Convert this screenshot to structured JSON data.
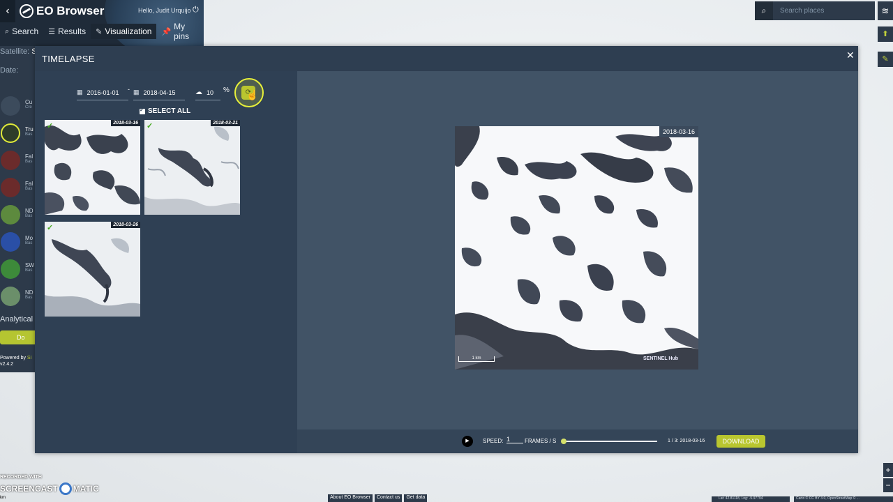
{
  "app": {
    "title": "EO Browser",
    "back_icon": "‹",
    "greeting": "Hello, Judit Urquijo",
    "tabs": [
      {
        "label": "Search",
        "icon": "search-icon"
      },
      {
        "label": "Results",
        "icon": "list-icon"
      },
      {
        "label": "Visualization",
        "icon": "brush-icon",
        "active": true
      },
      {
        "label": "My pins",
        "icon": "pin-icon"
      }
    ],
    "satellite_label": "Satellite:",
    "satellite_value": "S",
    "date_label": "Date:",
    "layers": [
      {
        "t1": "Cu",
        "t2": "Cre",
        "color": "#3c4b5c"
      },
      {
        "t1": "Tru",
        "t2": "Bas",
        "color": "#2e3d2a"
      },
      {
        "t1": "Fal",
        "t2": "Bas",
        "color": "#6b2b2b"
      },
      {
        "t1": "Fal",
        "t2": "Bas",
        "color": "#6b2b2b"
      },
      {
        "t1": "ND",
        "t2": "Bas",
        "color": "#5d8a3e"
      },
      {
        "t1": "Mo",
        "t2": "Bas",
        "color": "#2a4fa6"
      },
      {
        "t1": "SW",
        "t2": "Bas",
        "color": "#3d8a3a"
      },
      {
        "t1": "ND",
        "t2": "Bas",
        "color": "#6b8f6a"
      }
    ],
    "analytical": "Analytical |",
    "download_side": "Do",
    "powered_by": "Powered by",
    "powered_brand": "Si",
    "version": "v2.4.2"
  },
  "search_places": {
    "placeholder": "Search places"
  },
  "timelapse": {
    "title": "TIMELAPSE",
    "from_date": "2016-01-01",
    "date_separator": "-",
    "to_date": "2018-04-15",
    "cloud_coverage": "10",
    "cloud_unit": "%",
    "select_all": "SELECT ALL",
    "thumbnails": [
      {
        "date": "2018-03-16",
        "checked": true
      },
      {
        "date": "2018-03-21",
        "checked": true
      },
      {
        "date": "2018-03-26",
        "checked": true
      }
    ],
    "preview_date": "2018-03-16",
    "scale_label": "1 km",
    "hub_label": "SENTINEL Hub",
    "speed_label": "SPEED:",
    "speed_value": "1",
    "fps_label": "FRAMES / S",
    "frame_position": 0.0,
    "frame_counter": "1 / 3: 2018-03-16",
    "download_label": "DOWNLOAD"
  },
  "footer": {
    "recorded_with": "RECORDED WITH",
    "screencast": "SCREENCAST",
    "matic": "MATIC",
    "km": "km",
    "links": [
      "About EO Browser",
      "Contact us",
      "Get data"
    ],
    "latlng": "Lat: 42.81118, Lng: -5.97794",
    "attribution": "Carto © CC BY 3.0, OpenStreetMap © ..."
  },
  "colors": {
    "accent": "#b9c62f",
    "panel": "#2d3a4a",
    "modal": "#34465a"
  }
}
